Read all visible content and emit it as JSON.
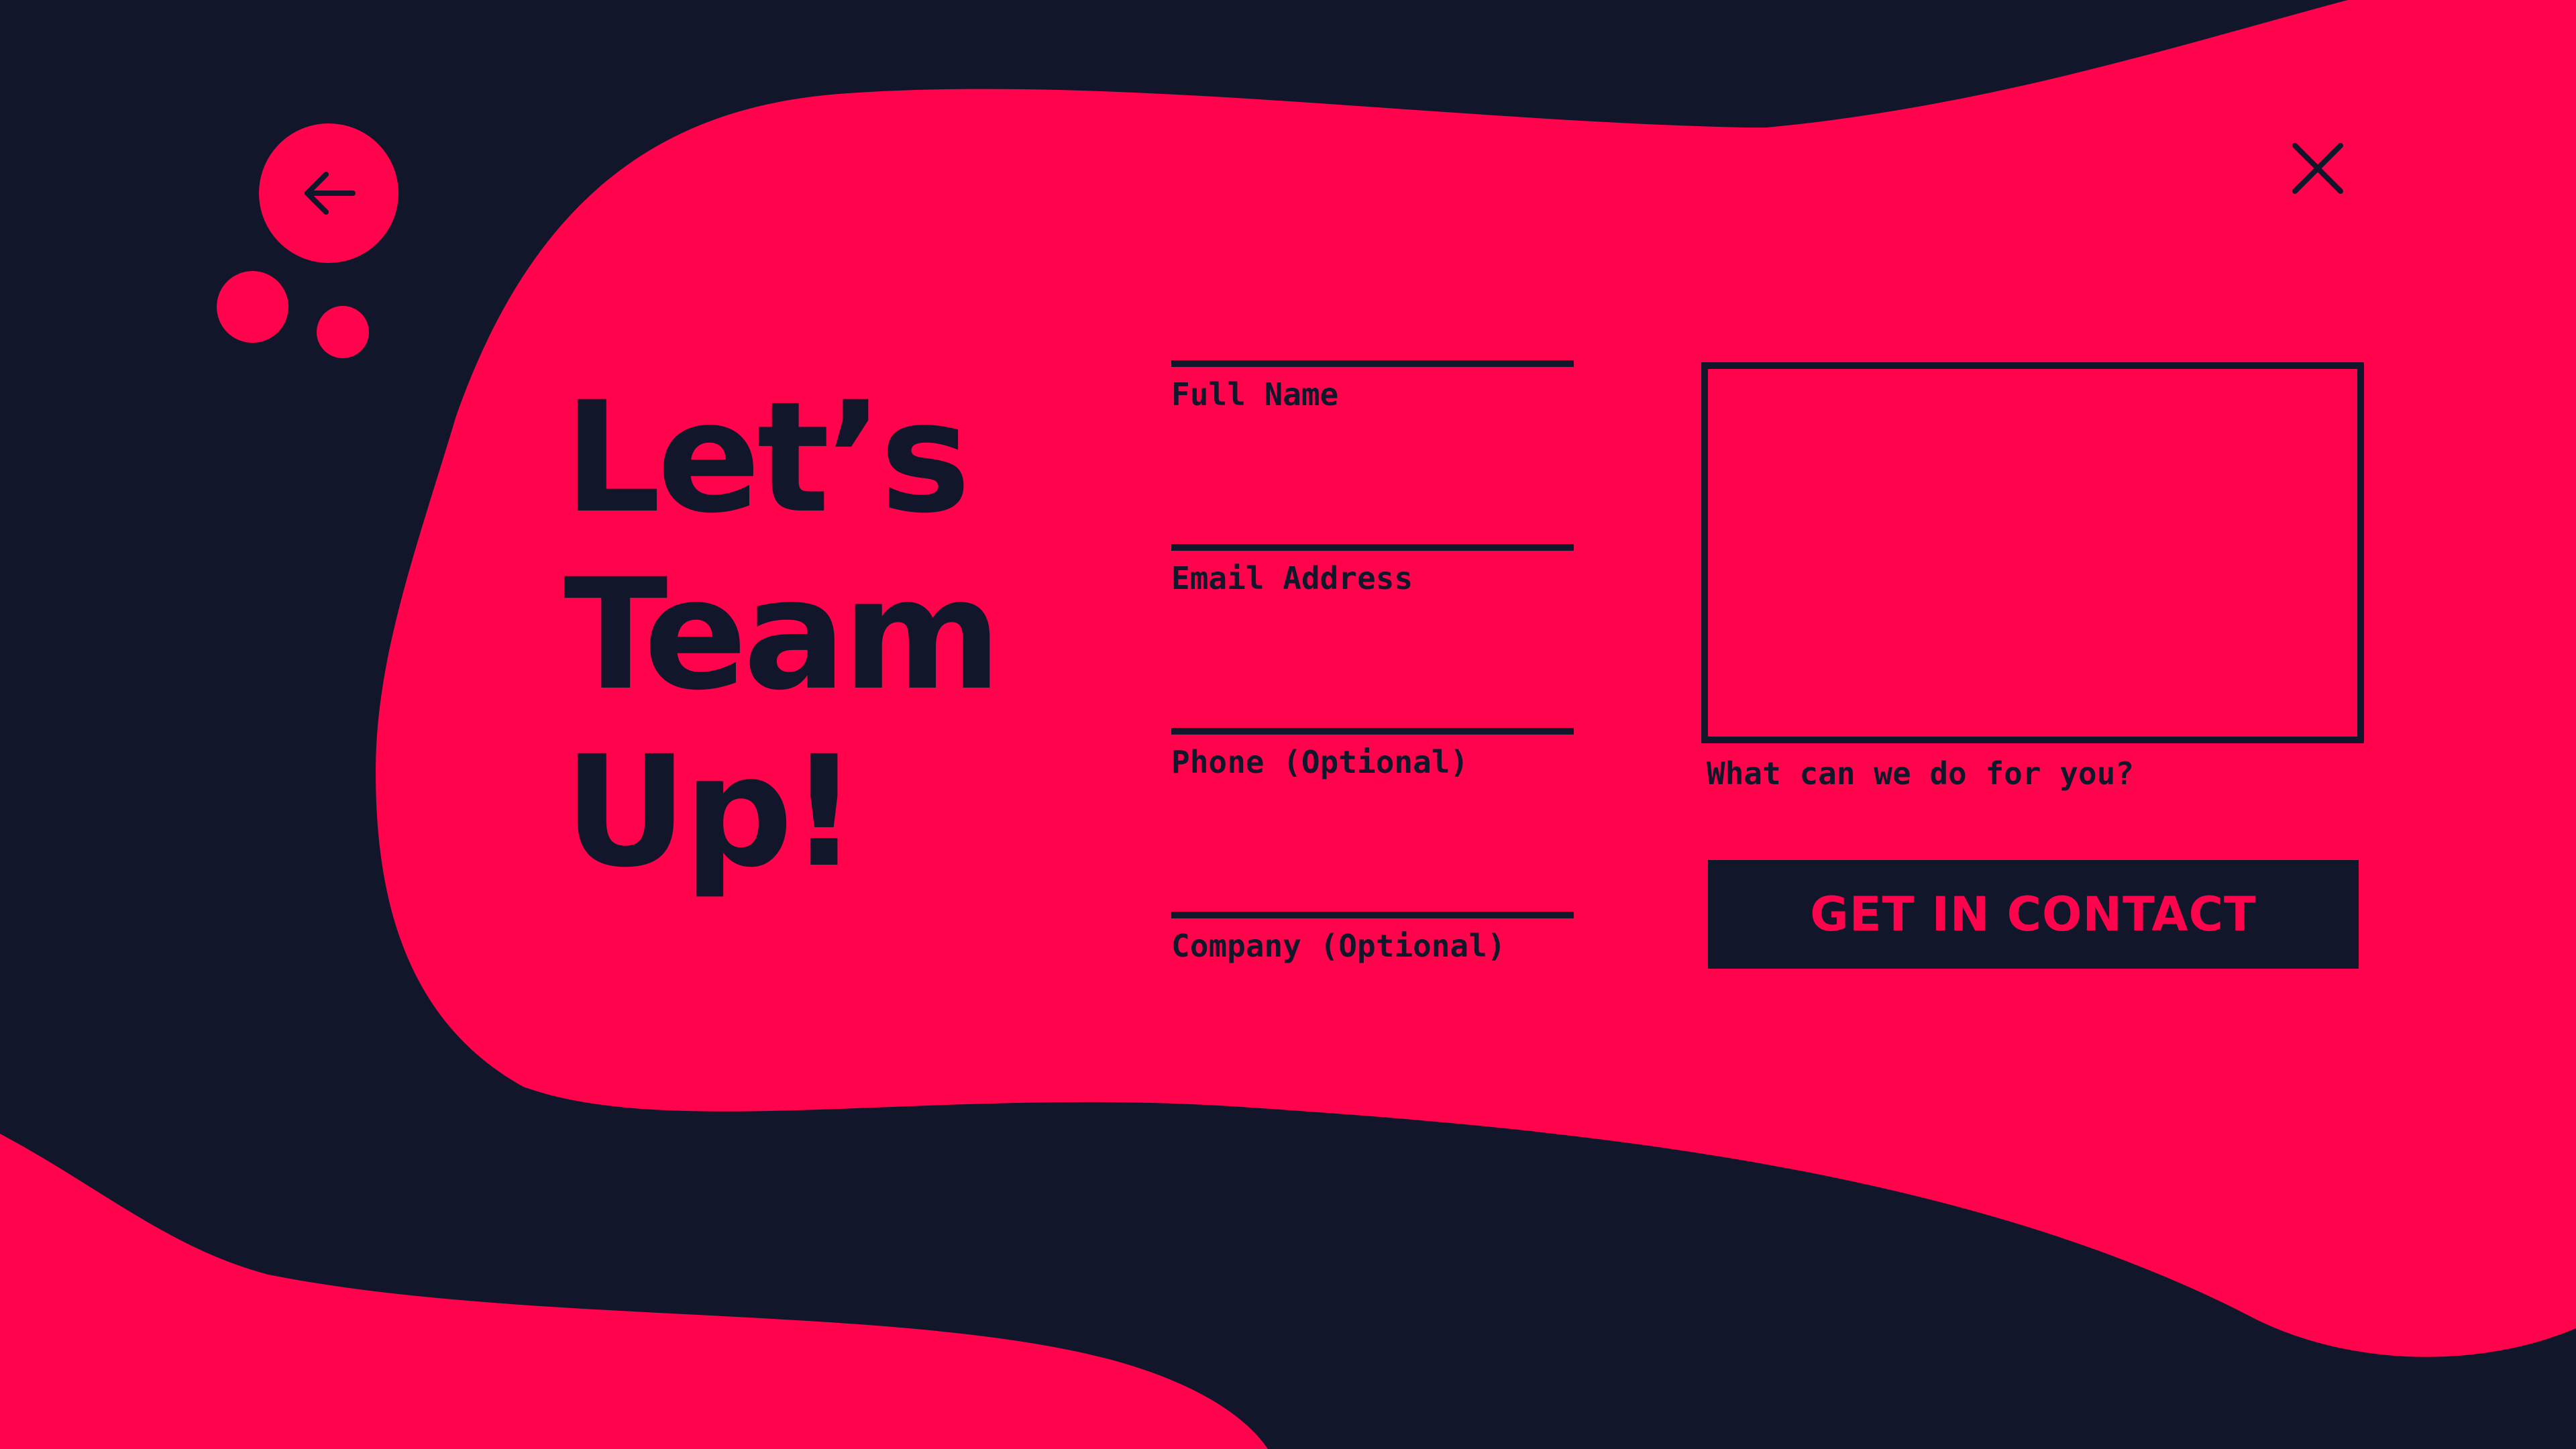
{
  "colors": {
    "background": "#11162b",
    "accent": "#ff034c",
    "ink": "#11162b"
  },
  "nav": {
    "back_icon": "arrow-left-icon",
    "close_icon": "close-icon"
  },
  "headline": {
    "line1": "Let’s",
    "line2": "Team",
    "line3": "Up!"
  },
  "form": {
    "fields": [
      {
        "label": "Full Name",
        "value": ""
      },
      {
        "label": "Email Address",
        "value": ""
      },
      {
        "label": "Phone (Optional)",
        "value": ""
      },
      {
        "label": "Company (Optional)",
        "value": ""
      }
    ],
    "message": {
      "label": "What can we do for you?",
      "value": ""
    },
    "submit_label": "GET IN CONTACT"
  }
}
